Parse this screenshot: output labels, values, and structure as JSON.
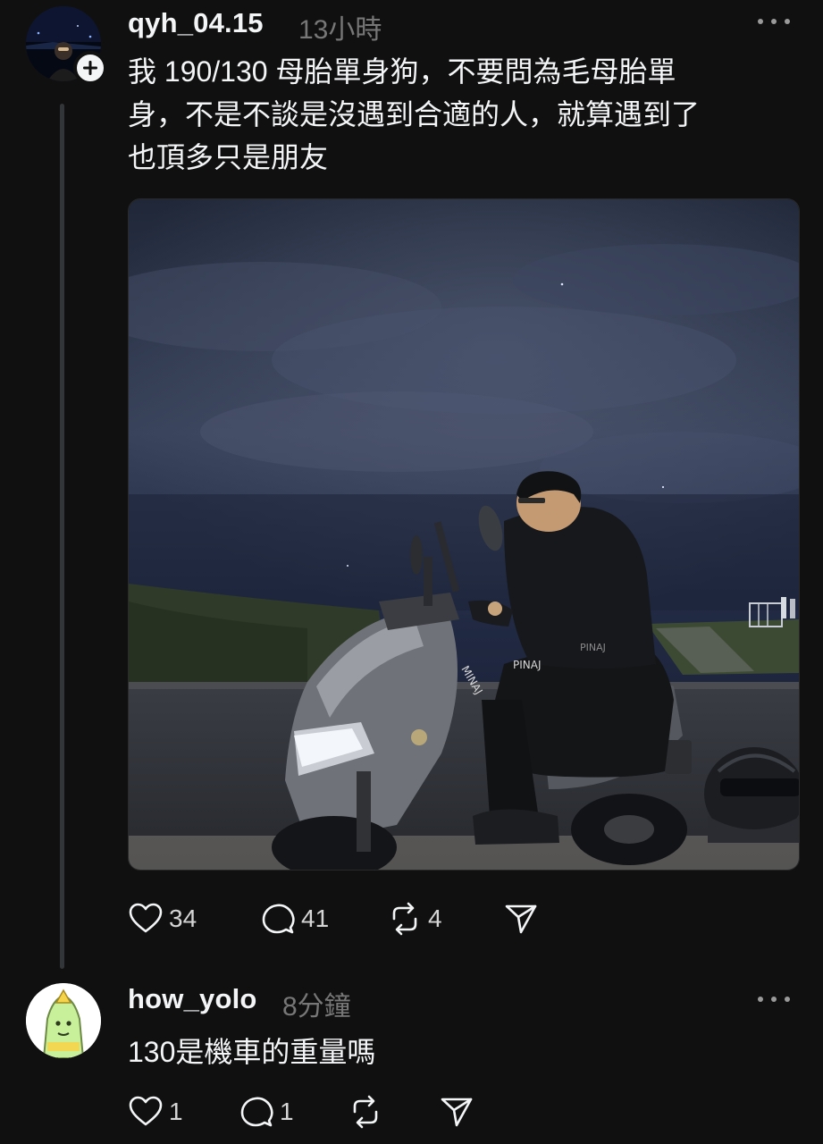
{
  "post": {
    "username": "qyh_04.15",
    "time": "13小時",
    "text_lines": [
      "我 190/130 母胎單身狗，不要問為毛母胎單",
      "身，不是不談是沒遇到合適的人，就算遇到了",
      "也頂多只是朋友"
    ],
    "likes": "34",
    "replies": "41",
    "reposts": "4",
    "icons": {
      "follow": "plus-icon",
      "more": "more-icon",
      "like": "heart-icon",
      "reply": "comment-icon",
      "repost": "repost-icon",
      "share": "send-icon"
    }
  },
  "reply": {
    "username": "how_yolo",
    "time": "8分鐘",
    "text": "130是機車的重量嗎",
    "likes": "1",
    "replies": "1"
  },
  "colors": {
    "background": "#101010",
    "text_primary": "#f3f5f7",
    "text_secondary": "#777777",
    "thread_line": "#333638"
  }
}
